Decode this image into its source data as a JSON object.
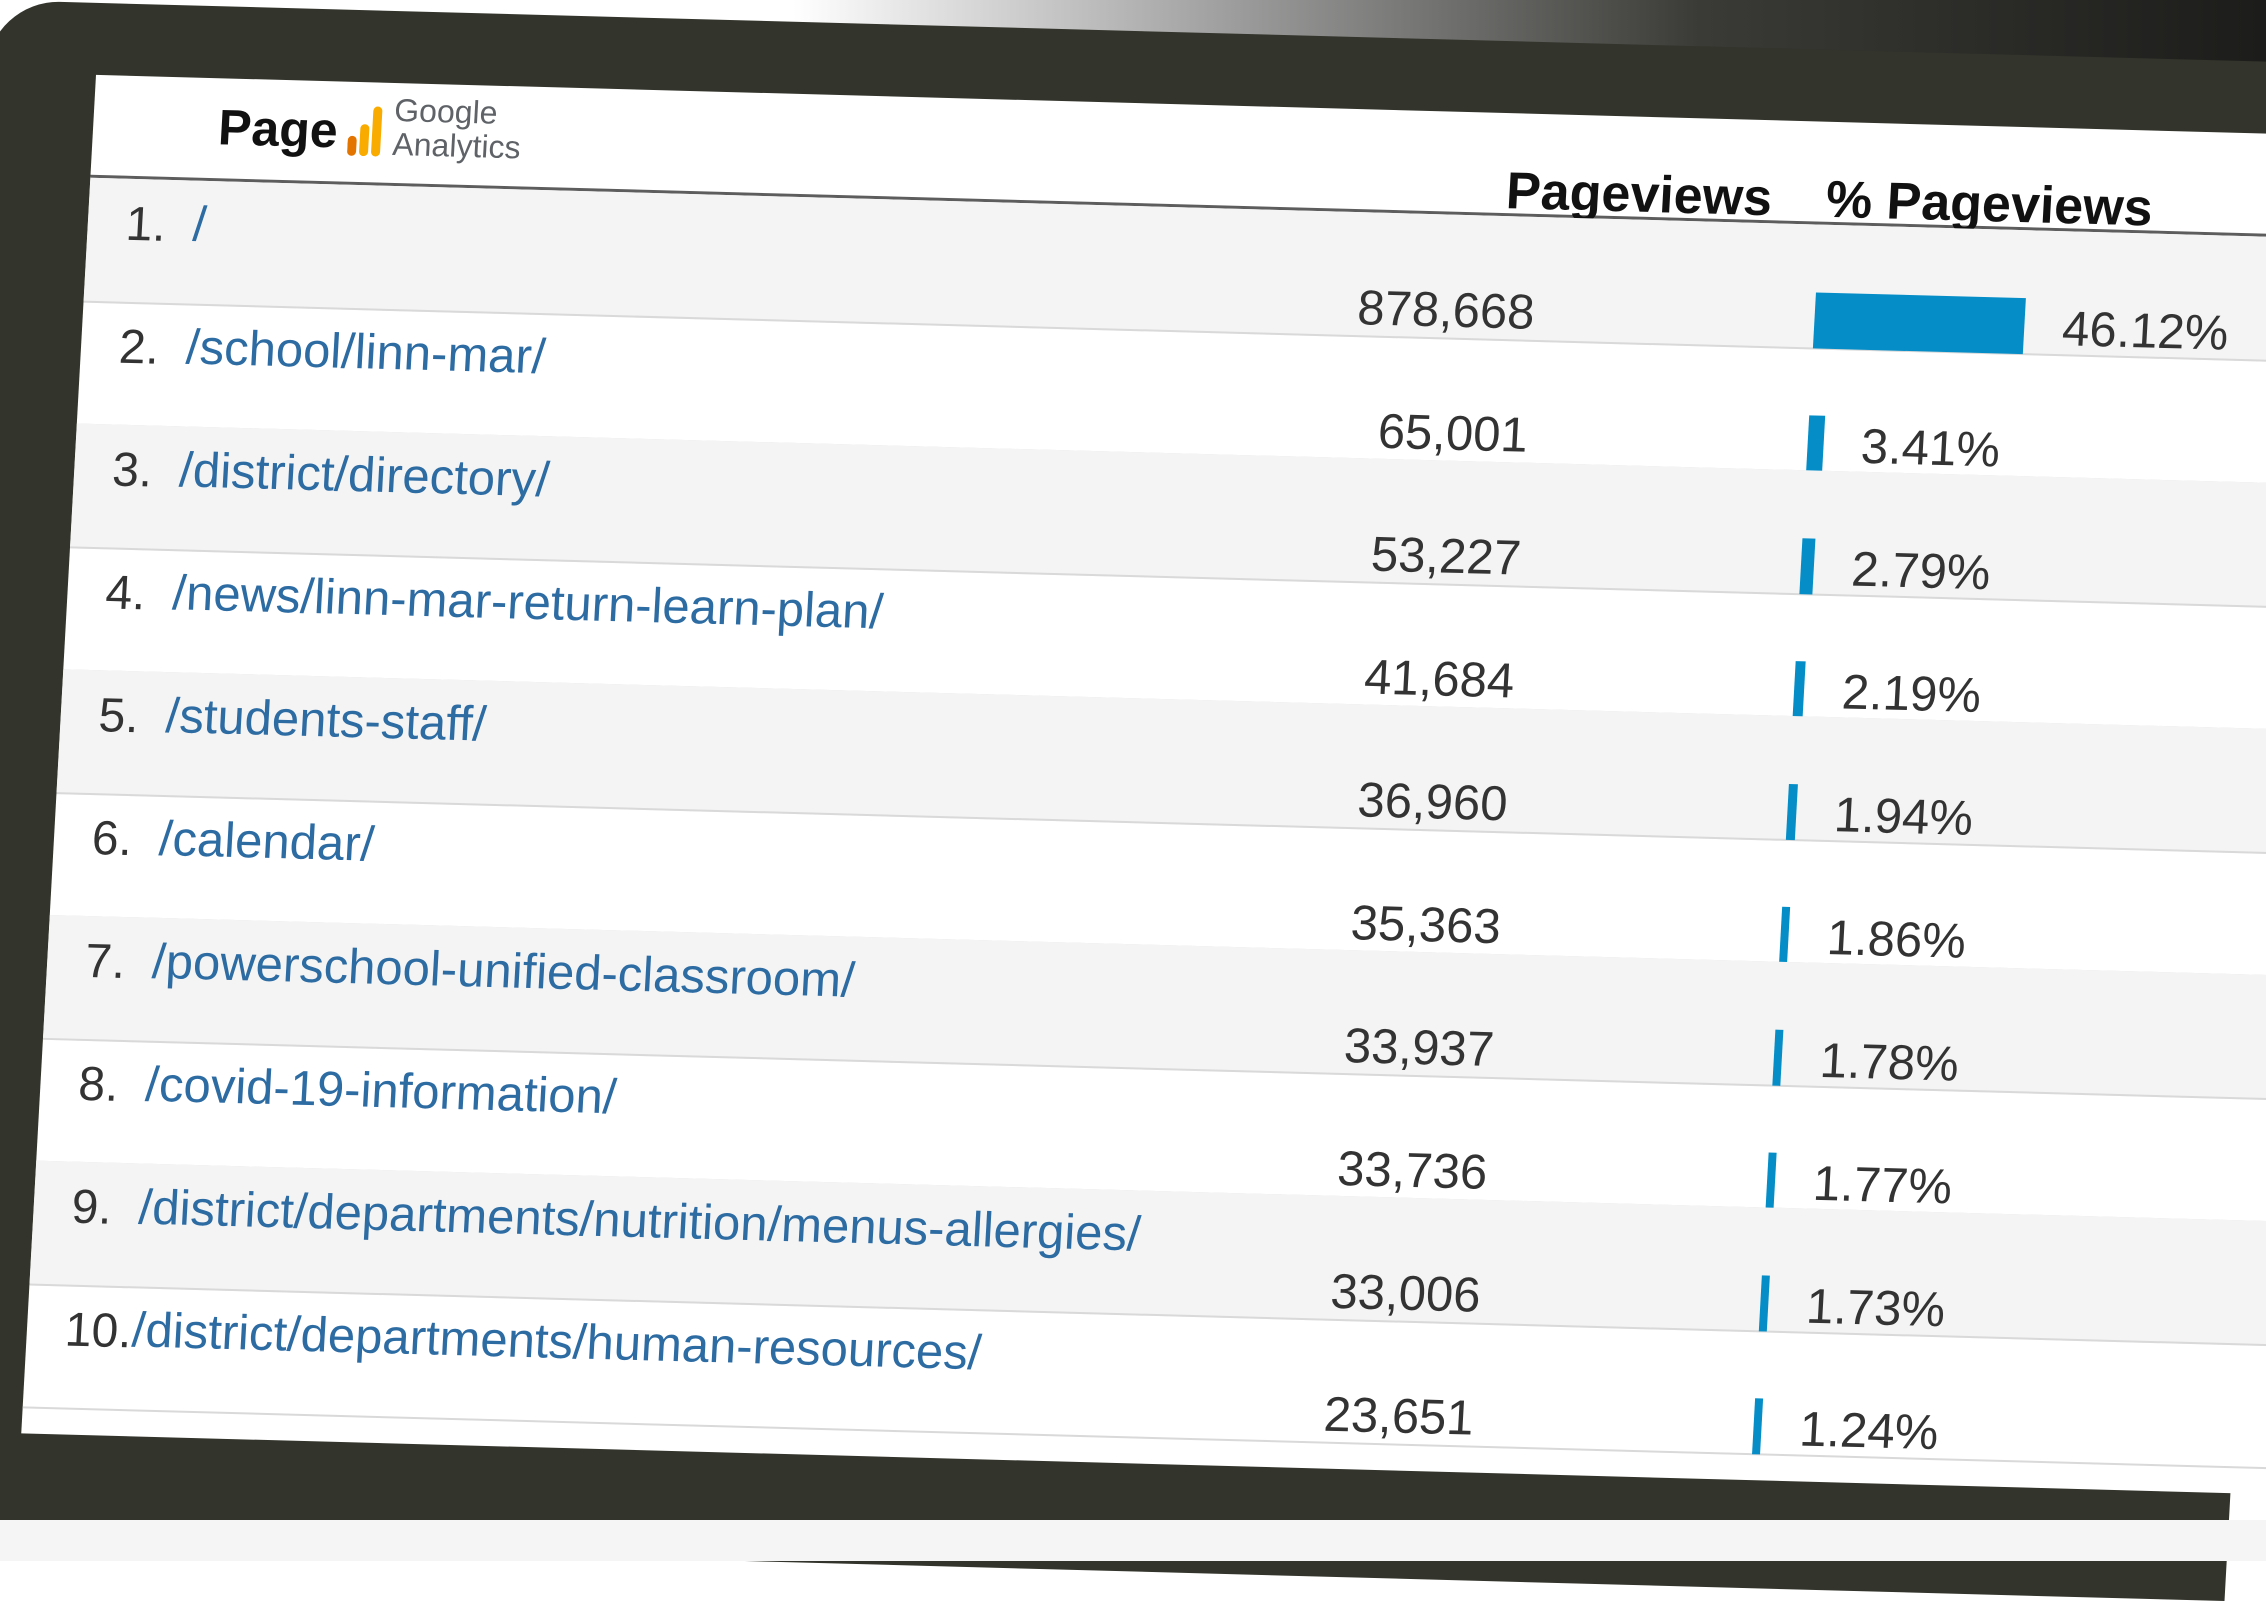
{
  "header": {
    "page_label": "Page",
    "logo_line1": "Google",
    "logo_line2": "Analytics",
    "pageviews_label": "Pageviews",
    "pct_pageviews_label": "% Pageviews"
  },
  "colors": {
    "bar": "#058dc7",
    "link": "#2d6ba3",
    "frame": "#33342b"
  },
  "rows": [
    {
      "rank": "1.",
      "path": "/",
      "pageviews": "878,668",
      "pct": "46.12%",
      "share": 46.12
    },
    {
      "rank": "2.",
      "path": "/school/linn-mar/",
      "pageviews": "65,001",
      "pct": "3.41%",
      "share": 3.41
    },
    {
      "rank": "3.",
      "path": "/district/directory/",
      "pageviews": "53,227",
      "pct": "2.79%",
      "share": 2.79
    },
    {
      "rank": "4.",
      "path": "/news/linn-mar-return-learn-plan/",
      "pageviews": "41,684",
      "pct": "2.19%",
      "share": 2.19
    },
    {
      "rank": "5.",
      "path": "/students-staff/",
      "pageviews": "36,960",
      "pct": "1.94%",
      "share": 1.94
    },
    {
      "rank": "6.",
      "path": "/calendar/",
      "pageviews": "35,363",
      "pct": "1.86%",
      "share": 1.86
    },
    {
      "rank": "7.",
      "path": "/powerschool-unified-classroom/",
      "pageviews": "33,937",
      "pct": "1.78%",
      "share": 1.78
    },
    {
      "rank": "8.",
      "path": "/covid-19-information/",
      "pageviews": "33,736",
      "pct": "1.77%",
      "share": 1.77
    },
    {
      "rank": "9.",
      "path": "/district/departments/nutrition/menus-allergies/",
      "pageviews": "33,006",
      "pct": "1.73%",
      "share": 1.73
    },
    {
      "rank": "10.",
      "path": "/district/departments/human-resources/",
      "pageviews": "23,651",
      "pct": "1.24%",
      "share": 1.24
    }
  ]
}
